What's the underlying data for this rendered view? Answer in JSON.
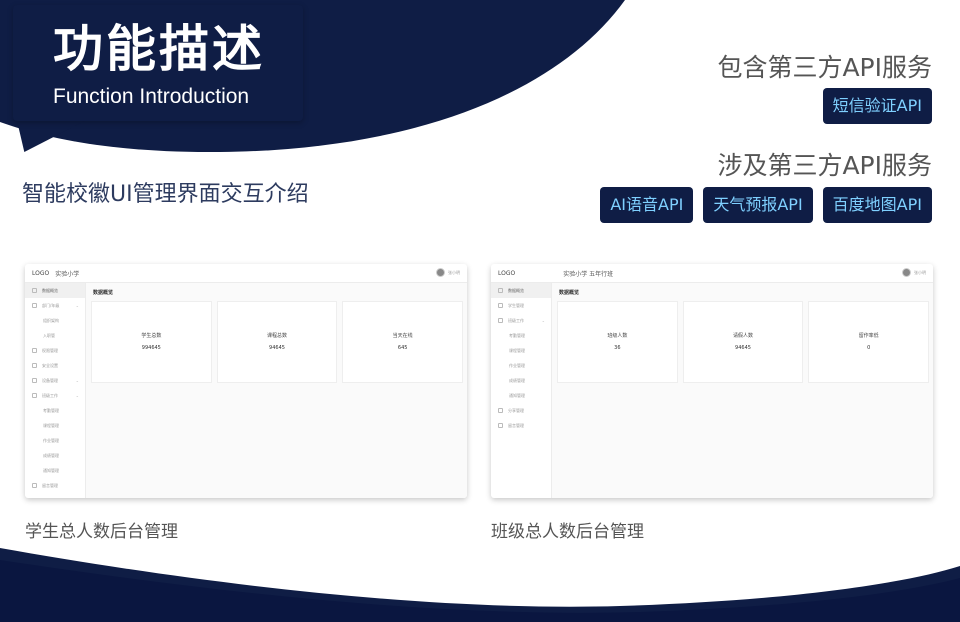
{
  "colors": {
    "navy": "#0f1d45",
    "navy_dark": "#081238",
    "accent": "#7fd0ff"
  },
  "header": {
    "title_cn": "功能描述",
    "title_en": "Function Introduction"
  },
  "subtitle": "智能校徽UI管理界面交互介绍",
  "api": {
    "included_heading": "包含第三方API服务",
    "included": [
      "短信验证API"
    ],
    "involved_heading": "涉及第三方API服务",
    "involved": [
      "AI语音API",
      "天气预报API",
      "百度地图API"
    ]
  },
  "screens": [
    {
      "logo": "LOGO",
      "school": "实验小学",
      "user": "张小明",
      "page_title": "数据概览",
      "menu": [
        {
          "label": "数据概览",
          "active": true,
          "sub": false,
          "icon": "grid-icon"
        },
        {
          "label": "部门/年级",
          "active": false,
          "sub": false,
          "icon": "user-icon",
          "caret": true
        },
        {
          "label": "组织架构",
          "active": false,
          "sub": true
        },
        {
          "label": "入职管",
          "active": false,
          "sub": true
        },
        {
          "label": "权限管理",
          "active": false,
          "sub": false,
          "icon": "gear-icon"
        },
        {
          "label": "安全设置",
          "active": false,
          "sub": false,
          "icon": "shield-icon"
        },
        {
          "label": "设备管理",
          "active": false,
          "sub": false,
          "icon": "device-icon",
          "caret": true
        },
        {
          "label": "班级工作",
          "active": false,
          "sub": false,
          "icon": "list-icon",
          "caret": true
        },
        {
          "label": "考勤管理",
          "active": false,
          "sub": true
        },
        {
          "label": "课程管理",
          "active": false,
          "sub": true
        },
        {
          "label": "作业管理",
          "active": false,
          "sub": true
        },
        {
          "label": "成绩管理",
          "active": false,
          "sub": true
        },
        {
          "label": "通知管理",
          "active": false,
          "sub": true
        },
        {
          "label": "留言管理",
          "active": false,
          "sub": false,
          "icon": "upload-icon"
        }
      ],
      "cards": [
        {
          "label": "学生总数",
          "value": "994645"
        },
        {
          "label": "课程总数",
          "value": "94645"
        },
        {
          "label": "当天在线",
          "value": "645"
        }
      ],
      "caption": "学生总人数后台管理"
    },
    {
      "logo": "LOGO",
      "school": "实验小学 五年行班",
      "user": "张小明",
      "page_title": "数据概览",
      "menu": [
        {
          "label": "数据概览",
          "active": true,
          "sub": false,
          "icon": "grid-icon"
        },
        {
          "label": "学生管理",
          "active": false,
          "sub": false,
          "icon": "user-icon"
        },
        {
          "label": "班级工作",
          "active": false,
          "sub": false,
          "icon": "list-icon",
          "caret": true
        },
        {
          "label": "考勤管理",
          "active": false,
          "sub": true
        },
        {
          "label": "课程管理",
          "active": false,
          "sub": true
        },
        {
          "label": "作业管理",
          "active": false,
          "sub": true
        },
        {
          "label": "成绩管理",
          "active": false,
          "sub": true
        },
        {
          "label": "通知管理",
          "active": false,
          "sub": true
        },
        {
          "label": "分享管理",
          "active": false,
          "sub": false,
          "icon": "share-icon"
        },
        {
          "label": "留言管理",
          "active": false,
          "sub": false,
          "icon": "upload-icon"
        }
      ],
      "cards": [
        {
          "label": "班级人数",
          "value": "36"
        },
        {
          "label": "请假人数",
          "value": "94645"
        },
        {
          "label": "留作率低",
          "value": "0"
        }
      ],
      "caption": "班级总人数后台管理"
    }
  ]
}
